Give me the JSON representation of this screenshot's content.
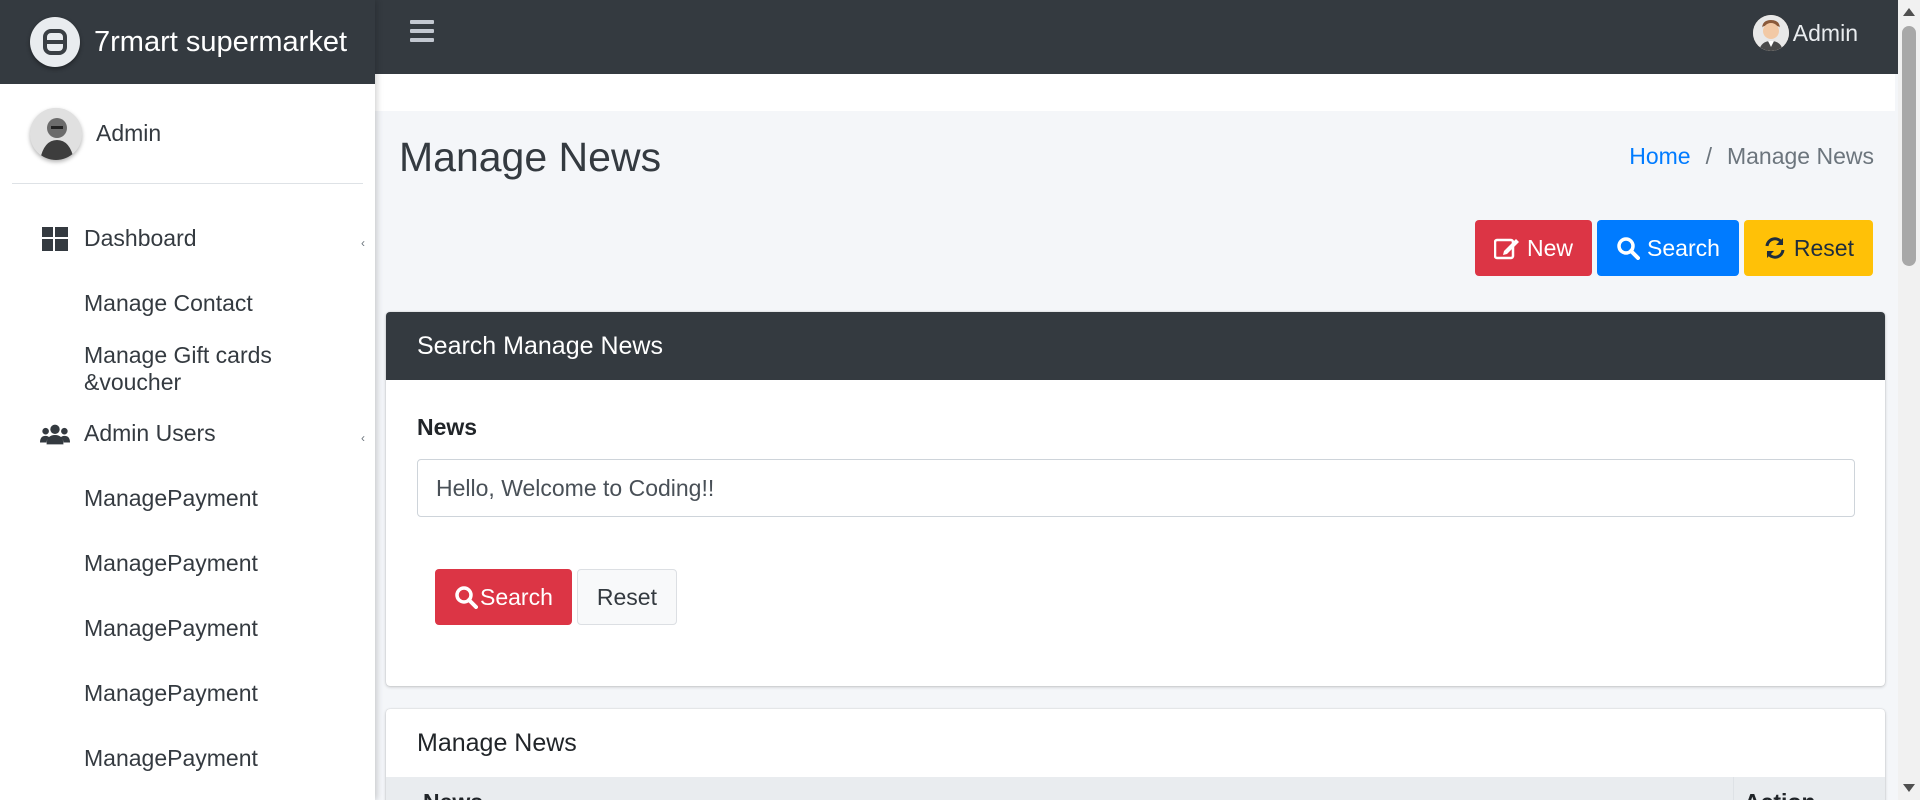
{
  "brand": {
    "name": "7rmart supermarket",
    "logo_icon": "brand-logo-icon"
  },
  "sidebar": {
    "user_name": "Admin",
    "items": [
      {
        "label": "Dashboard",
        "type": "parent",
        "icon": "dashboard-icon"
      },
      {
        "label": "Manage Contact",
        "type": "child"
      },
      {
        "label": "Manage Gift cards &voucher",
        "type": "child"
      },
      {
        "label": "Admin Users",
        "type": "parent",
        "icon": "users-icon"
      },
      {
        "label": "ManagePayment",
        "type": "child"
      },
      {
        "label": "ManagePayment",
        "type": "child"
      },
      {
        "label": "ManagePayment",
        "type": "child"
      },
      {
        "label": "ManagePayment",
        "type": "child"
      },
      {
        "label": "ManagePayment",
        "type": "child"
      }
    ]
  },
  "topbar": {
    "user_name": "Admin"
  },
  "page": {
    "title": "Manage News",
    "breadcrumb": {
      "home": "Home",
      "current": "Manage News"
    }
  },
  "actions": {
    "new": "New",
    "search": "Search",
    "reset": "Reset"
  },
  "search_card": {
    "title": "Search Manage News",
    "field_label": "News",
    "field_value": "Hello, Welcome to Coding!!",
    "search_button": "Search",
    "reset_button": "Reset"
  },
  "list_card": {
    "title": "Manage News",
    "columns": [
      "News",
      "Action"
    ]
  },
  "colors": {
    "dark": "#343a40",
    "danger": "#dc3545",
    "primary": "#007bff",
    "warning": "#ffc107",
    "content_bg": "#f4f6f9"
  }
}
